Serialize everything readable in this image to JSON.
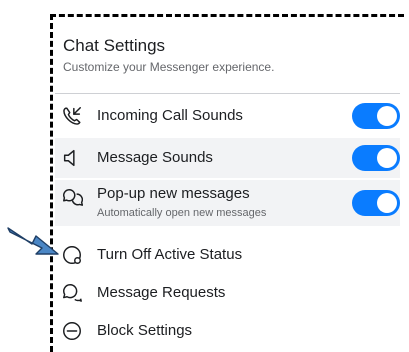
{
  "header": {
    "title": "Chat Settings",
    "subtitle": "Customize your Messenger experience."
  },
  "toggles": [
    {
      "label": "Incoming Call Sounds",
      "icon": "phone-incoming-icon",
      "on": true
    },
    {
      "label": "Message Sounds",
      "icon": "speaker-icon",
      "on": true
    },
    {
      "label": "Pop-up new messages",
      "sublabel": "Automatically open new messages",
      "icon": "chat-bubbles-icon",
      "on": true
    }
  ],
  "menu": [
    {
      "label": "Turn Off Active Status",
      "icon": "active-status-icon"
    },
    {
      "label": "Message Requests",
      "icon": "message-requests-icon"
    },
    {
      "label": "Block Settings",
      "icon": "block-icon"
    }
  ],
  "colors": {
    "toggle_on": "#0a7cff",
    "row_highlight": "#f2f3f5",
    "pointer_arrow": "#4a86c5"
  }
}
